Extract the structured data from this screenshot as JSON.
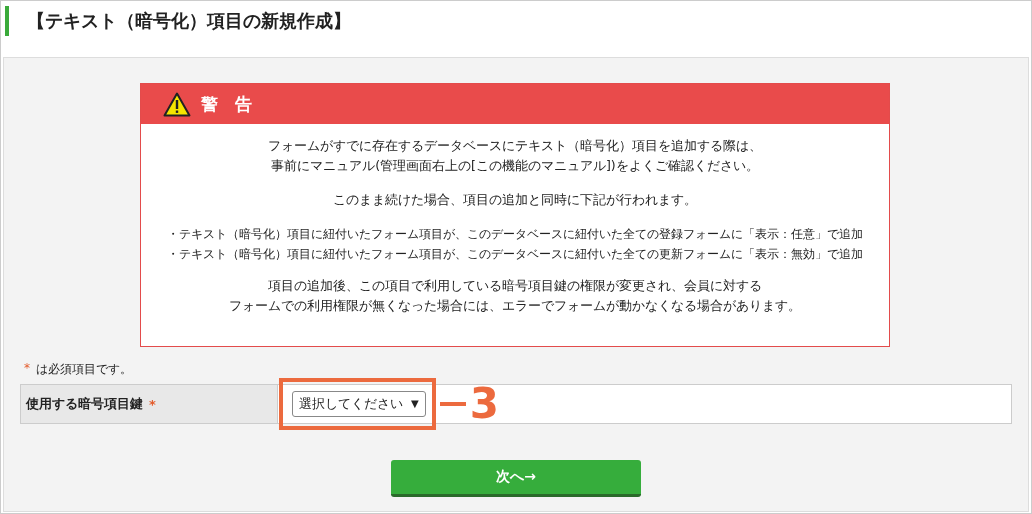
{
  "page_title": "【テキスト（暗号化）項目の新規作成】",
  "warning": {
    "title": "警　告",
    "paragraphs": [
      [
        "フォームがすでに存在するデータベースにテキスト（暗号化）項目を追加する際は、",
        "事前にマニュアル(管理画面右上の[この機能のマニュアル])をよくご確認ください。"
      ],
      [
        "このまま続けた場合、項目の追加と同時に下記が行われます。"
      ]
    ],
    "bullets": [
      "・テキスト（暗号化）項目に紐付いたフォーム項目が、このデータベースに紐付いた全ての登録フォームに「表示：任意」で追加",
      "・テキスト（暗号化）項目に紐付いたフォーム項目が、このデータベースに紐付いた全ての更新フォームに「表示：無効」で追加"
    ],
    "footer": [
      "項目の追加後、この項目で利用している暗号項目鍵の権限が変更され、会員に対する",
      "フォームでの利用権限が無くなった場合には、エラーでフォームが動かなくなる場合があります。"
    ]
  },
  "required_note": {
    "mark": "*",
    "text": "は必須項目です。"
  },
  "form": {
    "label": "使用する暗号項目鍵",
    "required": true,
    "select": {
      "value": "選択してください",
      "arrow": "▼"
    }
  },
  "annotation": {
    "label": "3"
  },
  "next_button": "次へ→"
}
